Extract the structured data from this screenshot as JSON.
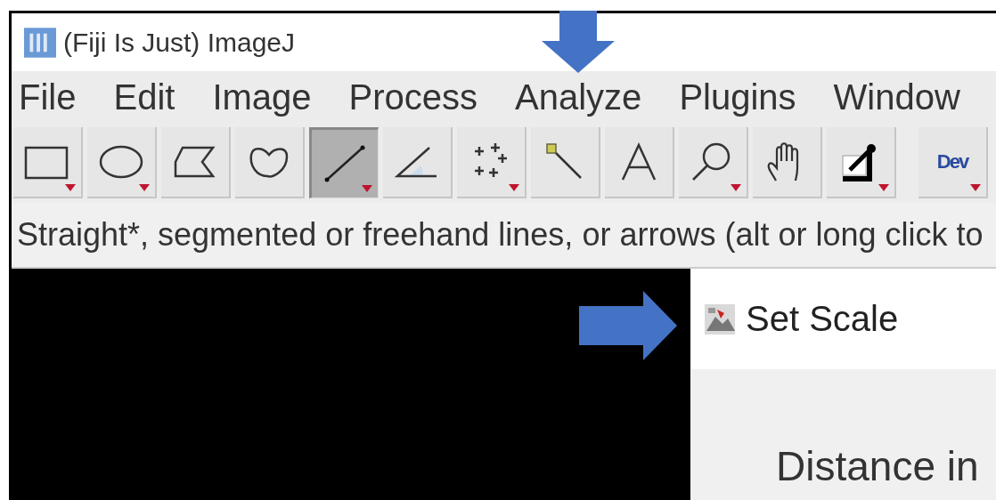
{
  "window": {
    "title": "(Fiji Is Just) ImageJ"
  },
  "menu": [
    "File",
    "Edit",
    "Image",
    "Process",
    "Analyze",
    "Plugins",
    "Window"
  ],
  "tools": [
    {
      "kind": "rectangle",
      "selected": false,
      "has_menu": true
    },
    {
      "kind": "oval",
      "selected": false,
      "has_menu": true
    },
    {
      "kind": "polygon",
      "selected": false,
      "has_menu": false
    },
    {
      "kind": "freehand",
      "selected": false,
      "has_menu": false
    },
    {
      "kind": "line",
      "selected": true,
      "has_menu": true
    },
    {
      "kind": "angle",
      "selected": false,
      "has_menu": false
    },
    {
      "kind": "multipoint",
      "selected": false,
      "has_menu": true
    },
    {
      "kind": "wand",
      "selected": false,
      "has_menu": false
    },
    {
      "kind": "text",
      "selected": false,
      "has_menu": false
    },
    {
      "kind": "magnifier",
      "selected": false,
      "has_menu": true
    },
    {
      "kind": "hand",
      "selected": false,
      "has_menu": false
    },
    {
      "kind": "picker",
      "selected": false,
      "has_menu": true
    },
    {
      "kind": "label",
      "label": "Dev",
      "selected": false,
      "has_menu": true
    }
  ],
  "status_bar": "Straight*, segmented or freehand lines, or arrows (alt or long click to",
  "dialog": {
    "title": "Set Scale",
    "label": "Distance in"
  }
}
